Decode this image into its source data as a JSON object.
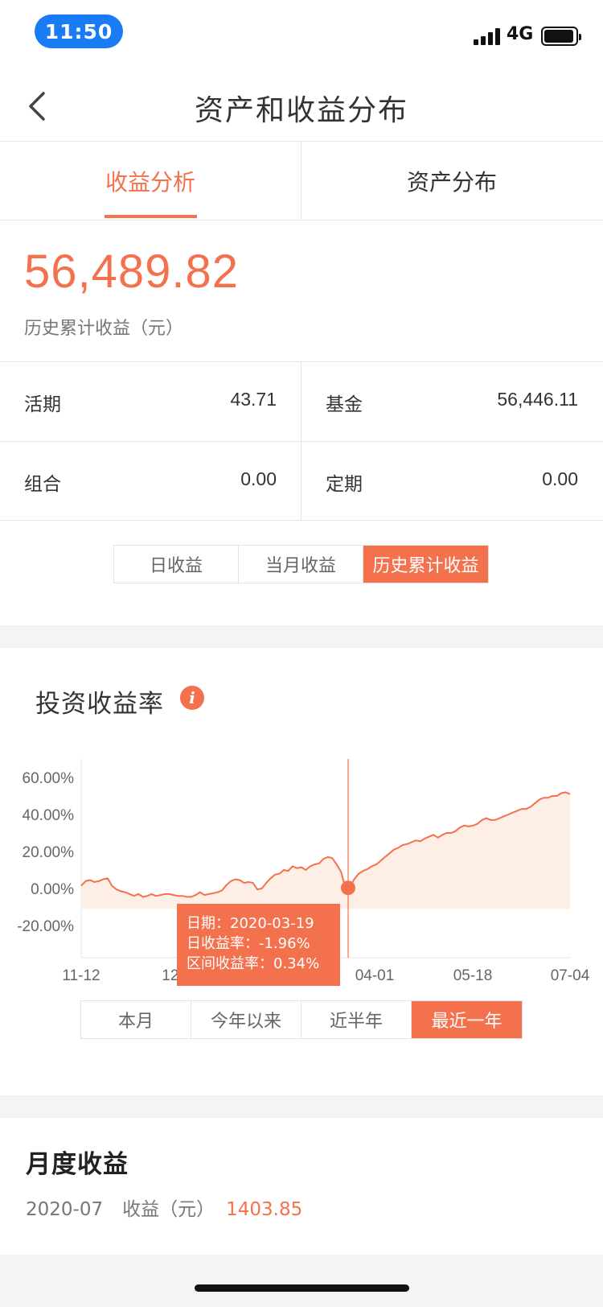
{
  "status": {
    "time": "11:50",
    "network": "4G"
  },
  "nav": {
    "title": "资产和收益分布"
  },
  "tabs": [
    {
      "label": "收益分析",
      "active": true
    },
    {
      "label": "资产分布",
      "active": false
    }
  ],
  "summary": {
    "total": "56,489.82",
    "label": "历史累计收益（元）"
  },
  "breakdown": [
    {
      "label": "活期",
      "value": "43.71"
    },
    {
      "label": "基金",
      "value": "56,446.11"
    },
    {
      "label": "组合",
      "value": "0.00"
    },
    {
      "label": "定期",
      "value": "0.00"
    }
  ],
  "earnings_toggle": [
    "日收益",
    "当月收益",
    "历史累计收益"
  ],
  "earnings_toggle_active": 2,
  "chart_section": {
    "title": "投资收益率"
  },
  "tooltip": {
    "date": "日期：2020-03-19",
    "daily": "日收益率：-1.96%",
    "range": "区间收益率：0.34%"
  },
  "period_toggle": [
    "本月",
    "今年以来",
    "近半年",
    "最近一年"
  ],
  "period_toggle_active": 3,
  "monthly": {
    "title": "月度收益",
    "month": "2020-07",
    "label": "收益（元）",
    "amount": "1403.85"
  },
  "colors": {
    "accent": "#f4714e",
    "area_fill": "#fdeee6",
    "status_pill": "#1a7cf5"
  },
  "chart_data": {
    "type": "area",
    "x_ticks": [
      "11-12",
      "12-",
      "04-01",
      "05-18",
      "07-04"
    ],
    "y_ticks": [
      "60.00%",
      "40.00%",
      "20.00%",
      "0.00%",
      "-20.00%"
    ],
    "ylim": [
      -20,
      60
    ],
    "highlight": {
      "x": "2020-03-19",
      "y": 0.34
    },
    "series": [
      {
        "values": [
          1.5,
          4,
          4.5,
          3.5,
          4,
          5,
          5.5,
          1.5,
          -0.5,
          -1.5,
          -2,
          -3,
          -4,
          -3,
          -4.5,
          -4,
          -3,
          -4,
          -3.5,
          -3,
          -3,
          -3.5,
          -4,
          -4,
          -4.5,
          -4.5,
          -3.5,
          -2,
          -3.5,
          -3,
          -2.5,
          -2,
          -1,
          2,
          4,
          5,
          4.5,
          3,
          3.5,
          3,
          -0.5,
          0,
          3,
          5.5,
          7.5,
          8,
          10,
          9.5,
          12,
          11,
          11.5,
          10,
          12,
          13,
          13.5,
          16,
          17,
          16.5,
          13,
          9,
          0.34,
          1,
          5,
          8,
          9.5,
          10.5,
          12,
          13,
          15,
          17,
          19,
          21,
          22,
          23.5,
          24,
          25,
          26,
          25.5,
          27,
          28,
          29,
          27.5,
          29,
          30,
          30,
          31,
          33,
          34,
          33.5,
          34,
          35,
          37,
          38,
          37,
          37,
          38,
          39,
          40,
          41,
          42,
          43,
          43,
          44,
          46,
          48,
          49,
          49,
          50,
          50,
          51.5,
          52,
          51
        ]
      }
    ]
  }
}
